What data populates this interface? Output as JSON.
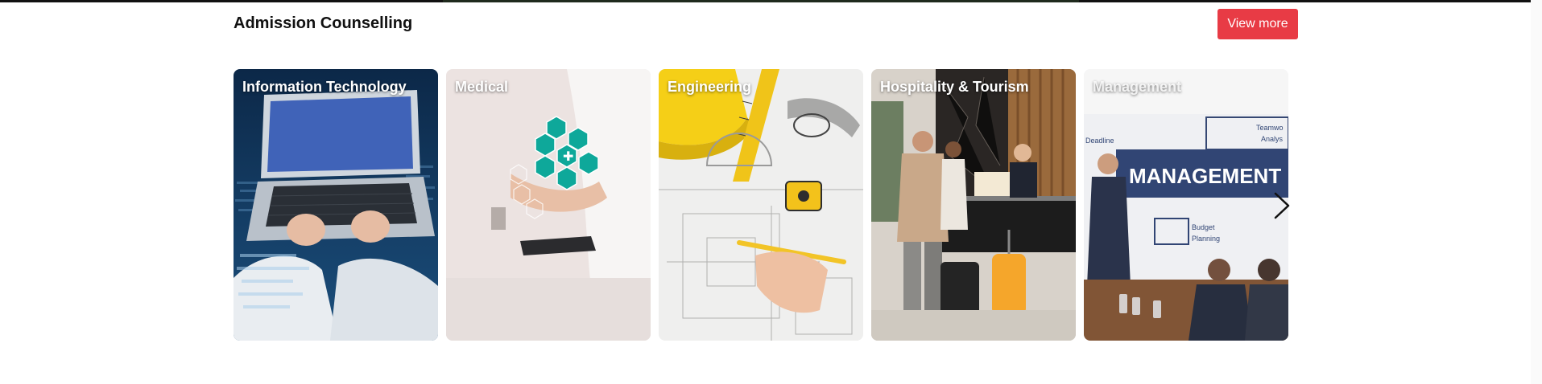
{
  "section": {
    "title": "Admission Counselling",
    "view_more_label": "View more"
  },
  "cards": [
    {
      "label": "Information Technology"
    },
    {
      "label": "Medical"
    },
    {
      "label": "Engineering"
    },
    {
      "label": "Hospitality & Tourism"
    },
    {
      "label": "Management",
      "sign_text": "MANAGEMENT",
      "board_texts": [
        "Deadline",
        "Teamwo",
        "Analys",
        "Budget",
        "Planning"
      ]
    }
  ],
  "carousel": {
    "next_icon": "chevron-right-icon"
  }
}
